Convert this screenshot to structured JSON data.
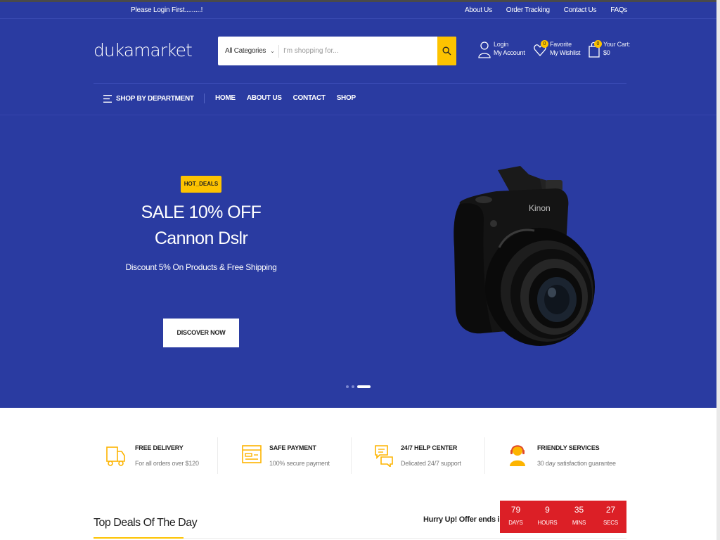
{
  "topbar": {
    "login_message": "Please Login First.........!",
    "links": [
      "About Us",
      "Order Tracking",
      "Contact Us",
      "FAQs"
    ]
  },
  "header": {
    "logo": "dukamarket",
    "search": {
      "category": "All Categories",
      "placeholder": "I'm shopping for..."
    },
    "account": {
      "line1": "Login",
      "line2": "My Account",
      "icon": "user-icon"
    },
    "wishlist": {
      "line1": "Favorite",
      "line2": "My Wishlist",
      "count": "0",
      "icon": "heart-icon"
    },
    "cart": {
      "line1": "Your Cart:",
      "line2": "$0",
      "count": "0",
      "icon": "shopping-bag-icon"
    }
  },
  "nav": {
    "department": "SHOP BY DEPARTMENT",
    "items": [
      "HOME",
      "ABOUT US",
      "CONTACT",
      "SHOP"
    ]
  },
  "hero": {
    "tag": "HOT_DEALS",
    "headline": "SALE 10% OFF",
    "product": "Cannon Dslr",
    "subtitle": "Discount 5% On Products & Free Shipping",
    "button": "DISCOVER NOW",
    "camera_brand": "Kinon",
    "slides": 3,
    "active_slide": 3
  },
  "features": [
    {
      "title": "FREE DELIVERY",
      "text": "For all orders over $120",
      "icon": "truck-icon"
    },
    {
      "title": "SAFE PAYMENT",
      "text": "100% secure payment",
      "icon": "credit-card-icon"
    },
    {
      "title": "24/7 HELP CENTER",
      "text": "Delicated 24/7 support",
      "icon": "chat-bubbles-icon"
    },
    {
      "title": "FRIENDLY SERVICES",
      "text": "30 day satisfaction guarantee",
      "icon": "support-agent-icon"
    }
  ],
  "deals": {
    "title": "Top Deals Of The Day",
    "hurry": "Hurry Up! Offer ends in:",
    "countdown": [
      {
        "value": "79",
        "unit": "DAYS"
      },
      {
        "value": "9",
        "unit": "HOURS"
      },
      {
        "value": "35",
        "unit": "MINS"
      },
      {
        "value": "27",
        "unit": "SECS"
      }
    ]
  },
  "colors": {
    "brand_blue": "#2a3ba1",
    "accent_yellow": "#fdc300",
    "countdown_red": "#dc1f26"
  }
}
